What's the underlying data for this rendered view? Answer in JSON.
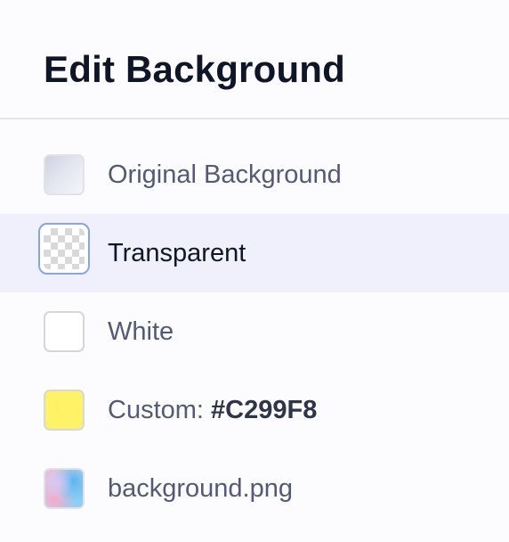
{
  "panel": {
    "title": "Edit Background"
  },
  "options": [
    {
      "label": "Original Background",
      "selected": false,
      "swatch": "original-gradient"
    },
    {
      "label": "Transparent",
      "selected": true,
      "swatch": "checkerboard"
    },
    {
      "label": "White",
      "selected": false,
      "swatch": "white",
      "color": "#ffffff"
    },
    {
      "label_prefix": "Custom:",
      "label_value": "#C299F8",
      "selected": false,
      "swatch": "custom-color",
      "color": "#FFF266"
    },
    {
      "label": "background.png",
      "selected": false,
      "swatch": "image-thumbnail"
    }
  ],
  "colors": {
    "selected_row": "#eff0fc",
    "selected_outline": "#8ea3e6",
    "title": "#0f1628",
    "label": "#525a74"
  }
}
